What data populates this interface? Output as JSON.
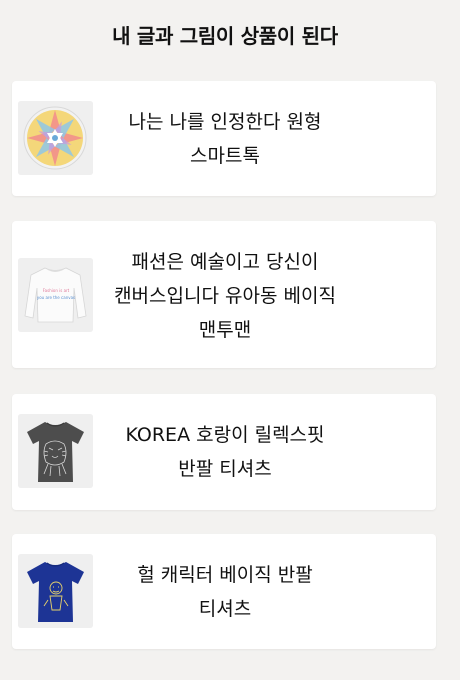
{
  "header": {
    "title": "내 글과 그림이 상품이 된다"
  },
  "products": [
    {
      "name": "나는 나를 인정한다 원형 스마트톡",
      "image": "mandala-smarttok-icon"
    },
    {
      "name": "패션은 예술이고 당신이 캔버스입니다 유아동 베이직 맨투맨",
      "image": "white-sweatshirt-icon",
      "print_text": "Fashion is art, you are the canvas"
    },
    {
      "name": "KOREA 호랑이 릴렉스핏 반팔 티셔츠",
      "image": "gray-tiger-tshirt-icon"
    },
    {
      "name": "헐 캐릭터 베이직 반팔 티셔츠",
      "image": "navy-character-tshirt-icon"
    }
  ],
  "colors": {
    "background": "#f3f2f0",
    "card": "#ffffff",
    "tshirt_gray": "#4d4d4d",
    "tshirt_navy": "#1d3495"
  }
}
